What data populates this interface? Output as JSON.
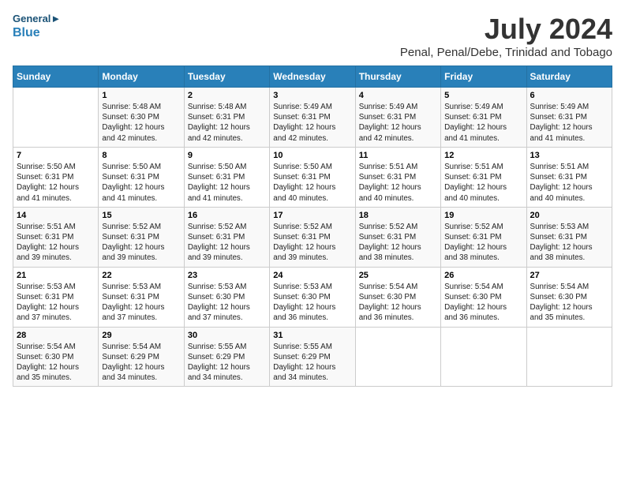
{
  "header": {
    "logo_line1": "General",
    "logo_line2": "Blue",
    "month_title": "July 2024",
    "location": "Penal, Penal/Debe, Trinidad and Tobago"
  },
  "days_of_week": [
    "Sunday",
    "Monday",
    "Tuesday",
    "Wednesday",
    "Thursday",
    "Friday",
    "Saturday"
  ],
  "weeks": [
    [
      {
        "day": "",
        "info": ""
      },
      {
        "day": "1",
        "info": "Sunrise: 5:48 AM\nSunset: 6:30 PM\nDaylight: 12 hours\nand 42 minutes."
      },
      {
        "day": "2",
        "info": "Sunrise: 5:48 AM\nSunset: 6:31 PM\nDaylight: 12 hours\nand 42 minutes."
      },
      {
        "day": "3",
        "info": "Sunrise: 5:49 AM\nSunset: 6:31 PM\nDaylight: 12 hours\nand 42 minutes."
      },
      {
        "day": "4",
        "info": "Sunrise: 5:49 AM\nSunset: 6:31 PM\nDaylight: 12 hours\nand 42 minutes."
      },
      {
        "day": "5",
        "info": "Sunrise: 5:49 AM\nSunset: 6:31 PM\nDaylight: 12 hours\nand 41 minutes."
      },
      {
        "day": "6",
        "info": "Sunrise: 5:49 AM\nSunset: 6:31 PM\nDaylight: 12 hours\nand 41 minutes."
      }
    ],
    [
      {
        "day": "7",
        "info": "Sunrise: 5:50 AM\nSunset: 6:31 PM\nDaylight: 12 hours\nand 41 minutes."
      },
      {
        "day": "8",
        "info": "Sunrise: 5:50 AM\nSunset: 6:31 PM\nDaylight: 12 hours\nand 41 minutes."
      },
      {
        "day": "9",
        "info": "Sunrise: 5:50 AM\nSunset: 6:31 PM\nDaylight: 12 hours\nand 41 minutes."
      },
      {
        "day": "10",
        "info": "Sunrise: 5:50 AM\nSunset: 6:31 PM\nDaylight: 12 hours\nand 40 minutes."
      },
      {
        "day": "11",
        "info": "Sunrise: 5:51 AM\nSunset: 6:31 PM\nDaylight: 12 hours\nand 40 minutes."
      },
      {
        "day": "12",
        "info": "Sunrise: 5:51 AM\nSunset: 6:31 PM\nDaylight: 12 hours\nand 40 minutes."
      },
      {
        "day": "13",
        "info": "Sunrise: 5:51 AM\nSunset: 6:31 PM\nDaylight: 12 hours\nand 40 minutes."
      }
    ],
    [
      {
        "day": "14",
        "info": "Sunrise: 5:51 AM\nSunset: 6:31 PM\nDaylight: 12 hours\nand 39 minutes."
      },
      {
        "day": "15",
        "info": "Sunrise: 5:52 AM\nSunset: 6:31 PM\nDaylight: 12 hours\nand 39 minutes."
      },
      {
        "day": "16",
        "info": "Sunrise: 5:52 AM\nSunset: 6:31 PM\nDaylight: 12 hours\nand 39 minutes."
      },
      {
        "day": "17",
        "info": "Sunrise: 5:52 AM\nSunset: 6:31 PM\nDaylight: 12 hours\nand 39 minutes."
      },
      {
        "day": "18",
        "info": "Sunrise: 5:52 AM\nSunset: 6:31 PM\nDaylight: 12 hours\nand 38 minutes."
      },
      {
        "day": "19",
        "info": "Sunrise: 5:52 AM\nSunset: 6:31 PM\nDaylight: 12 hours\nand 38 minutes."
      },
      {
        "day": "20",
        "info": "Sunrise: 5:53 AM\nSunset: 6:31 PM\nDaylight: 12 hours\nand 38 minutes."
      }
    ],
    [
      {
        "day": "21",
        "info": "Sunrise: 5:53 AM\nSunset: 6:31 PM\nDaylight: 12 hours\nand 37 minutes."
      },
      {
        "day": "22",
        "info": "Sunrise: 5:53 AM\nSunset: 6:31 PM\nDaylight: 12 hours\nand 37 minutes."
      },
      {
        "day": "23",
        "info": "Sunrise: 5:53 AM\nSunset: 6:30 PM\nDaylight: 12 hours\nand 37 minutes."
      },
      {
        "day": "24",
        "info": "Sunrise: 5:53 AM\nSunset: 6:30 PM\nDaylight: 12 hours\nand 36 minutes."
      },
      {
        "day": "25",
        "info": "Sunrise: 5:54 AM\nSunset: 6:30 PM\nDaylight: 12 hours\nand 36 minutes."
      },
      {
        "day": "26",
        "info": "Sunrise: 5:54 AM\nSunset: 6:30 PM\nDaylight: 12 hours\nand 36 minutes."
      },
      {
        "day": "27",
        "info": "Sunrise: 5:54 AM\nSunset: 6:30 PM\nDaylight: 12 hours\nand 35 minutes."
      }
    ],
    [
      {
        "day": "28",
        "info": "Sunrise: 5:54 AM\nSunset: 6:30 PM\nDaylight: 12 hours\nand 35 minutes."
      },
      {
        "day": "29",
        "info": "Sunrise: 5:54 AM\nSunset: 6:29 PM\nDaylight: 12 hours\nand 34 minutes."
      },
      {
        "day": "30",
        "info": "Sunrise: 5:55 AM\nSunset: 6:29 PM\nDaylight: 12 hours\nand 34 minutes."
      },
      {
        "day": "31",
        "info": "Sunrise: 5:55 AM\nSunset: 6:29 PM\nDaylight: 12 hours\nand 34 minutes."
      },
      {
        "day": "",
        "info": ""
      },
      {
        "day": "",
        "info": ""
      },
      {
        "day": "",
        "info": ""
      }
    ]
  ]
}
